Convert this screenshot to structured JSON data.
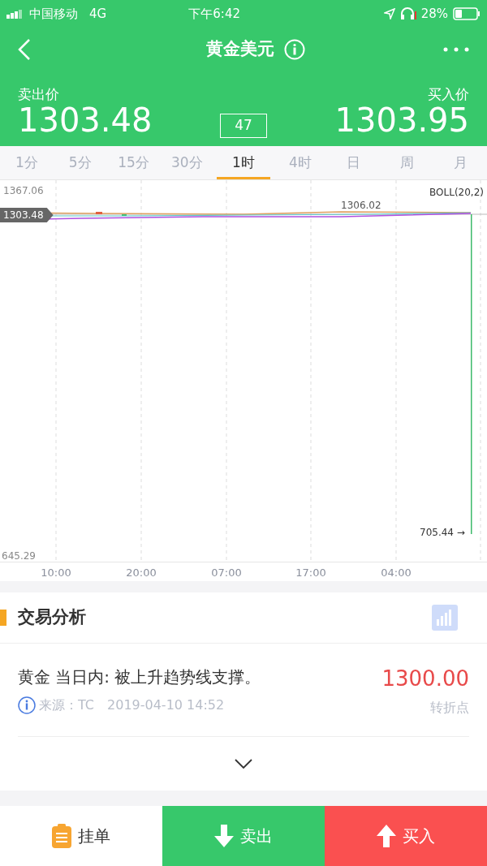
{
  "status_bar": {
    "carrier": "中国移动",
    "network": "4G",
    "time": "下午6:42",
    "battery": "28%"
  },
  "nav": {
    "title": "黄金美元"
  },
  "prices": {
    "sell_label": "卖出价",
    "sell": "1303.48",
    "spread": "47",
    "buy_label": "买入价",
    "buy": "1303.95"
  },
  "tabs": [
    {
      "label": "1分",
      "selected": false
    },
    {
      "label": "5分",
      "selected": false
    },
    {
      "label": "15分",
      "selected": false
    },
    {
      "label": "30分",
      "selected": false
    },
    {
      "label": "1时",
      "selected": true
    },
    {
      "label": "4时",
      "selected": false
    },
    {
      "label": "日",
      "selected": false
    },
    {
      "label": "周",
      "selected": false
    },
    {
      "label": "月",
      "selected": false
    }
  ],
  "chart": {
    "y_max": "1367.06",
    "y_min": "645.29",
    "indicator": "BOLL(20,2)",
    "price_tag": "1303.48",
    "high_marker": "1306.02",
    "low_marker": "705.44 →",
    "x_labels": [
      "10:00",
      "20:00",
      "07:00",
      "17:00",
      "04:00"
    ]
  },
  "analysis": {
    "title": "交易分析",
    "items": [
      {
        "headline": "黄金 当日内: 被上升趋势线支撑。",
        "source": "来源：TC",
        "datetime": "2019-04-10 14:52",
        "value": "1300.00",
        "value_label": "转折点"
      }
    ]
  },
  "actions": [
    {
      "kind": "order",
      "label": "挂单"
    },
    {
      "kind": "sell",
      "label": "卖出"
    },
    {
      "kind": "buy",
      "label": "买入"
    }
  ]
}
